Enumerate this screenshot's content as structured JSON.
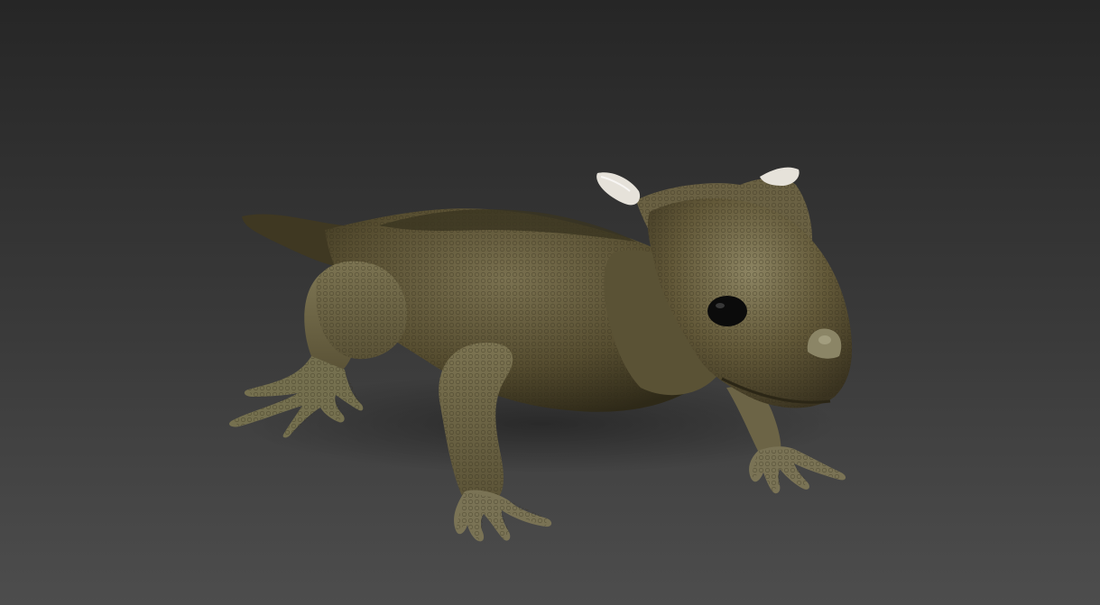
{
  "viewport": {
    "background_top": "#262626",
    "background_bottom": "#4d4d4d"
  },
  "subject": {
    "skin_color": "#5b5233",
    "skin_highlight": "#8a8260",
    "skin_shadow": "#2f2a18",
    "horn_color": "#e8e4dc",
    "eye_color": "#0b0b0b"
  }
}
